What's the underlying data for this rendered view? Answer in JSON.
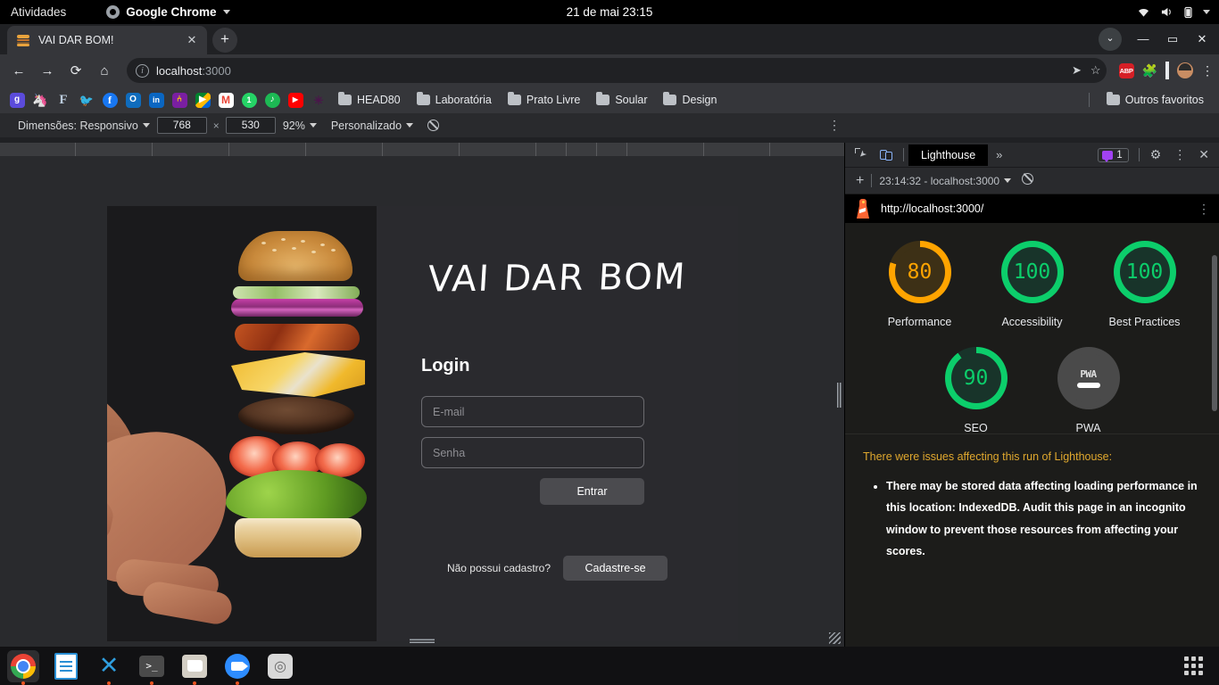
{
  "os_bar": {
    "activities": "Atividades",
    "app_name": "Google Chrome",
    "clock": "21 de mai  23:15",
    "tray": [
      "wifi-icon",
      "volume-icon",
      "battery-icon",
      "chevron-down-icon"
    ]
  },
  "browser": {
    "tab": {
      "title": "VAI DAR BOM!",
      "favicon": "burger-icon",
      "close": "✕"
    },
    "new_tab": "+",
    "window_controls": {
      "minimize": "—",
      "maximize": "▭",
      "close": "✕",
      "chevron": "⌄"
    },
    "nav": {
      "back": "←",
      "forward": "→",
      "reload": "⟳",
      "home": "⌂"
    },
    "omnibox": {
      "info_icon": "i",
      "host": "localhost",
      "port": ":3000",
      "share_icon": "➤",
      "star_icon": "☆"
    },
    "extensions": [
      "ABP",
      "puzzle-icon",
      "square-icon",
      "avatar-icon",
      "kebab-menu-icon"
    ],
    "bookmarks": {
      "icons": [
        "g",
        "unicorn",
        "F",
        "twitter",
        "facebook",
        "outlook",
        "linkedin",
        "analytics",
        "meet",
        "gmail",
        "whatsapp",
        "spotify",
        "youtube",
        "slack"
      ],
      "folders": [
        "HEAD80",
        "Laboratória",
        "Prato Livre",
        "Soular",
        "Design"
      ],
      "other": "Outros favoritos"
    }
  },
  "device_toolbar": {
    "dimensions_label": "Dimensões: Responsivo",
    "width": "768",
    "height": "530",
    "multiply": "×",
    "zoom": "92%",
    "preset": "Personalizado",
    "throttling_icon": "no-throttling-icon",
    "kebab": "⋮"
  },
  "page": {
    "logo": "VAI DAR BOM",
    "heading": "Login",
    "email_placeholder": "E-mail",
    "password_placeholder": "Senha",
    "email_value": "",
    "password_value": "",
    "submit_label": "Entrar",
    "signup_question": "Não possui cadastro?",
    "signup_label": "Cadastre-se",
    "hero_alt": "exploded-burger-on-hand-photo"
  },
  "devtools": {
    "tabs": {
      "active": "Lighthouse",
      "more": "»"
    },
    "badge_count": "1",
    "gear_icon": "⚙",
    "kebab_icon": "⋮",
    "close_icon": "✕",
    "lighthouse_toolbar": {
      "add": "+",
      "run_selector": "23:14:32 - localhost:3000",
      "clear_icon": "clear-icon"
    },
    "report": {
      "url": "http://localhost:3000/",
      "kebab": "⋮",
      "gauges": [
        {
          "label": "Performance",
          "score": "80",
          "color": "#ffa400",
          "bg": "#3d3016",
          "arc": 80
        },
        {
          "label": "Accessibility",
          "score": "100",
          "color": "#0cce6b",
          "bg": "#18342a",
          "arc": 100
        },
        {
          "label": "Best Practices",
          "score": "100",
          "color": "#0cce6b",
          "bg": "#18342a",
          "arc": 100
        },
        {
          "label": "SEO",
          "score": "90",
          "color": "#0cce6b",
          "bg": "#18342a",
          "arc": 90
        },
        {
          "label": "PWA",
          "score": "PWA",
          "color": "#e0e0e0",
          "bg": "#4a4a4a",
          "arc": 0
        }
      ],
      "warning_title": "There were issues affecting this run of Lighthouse:",
      "warning_items": [
        "There may be stored data affecting loading performance in this location: IndexedDB. Audit this page in an incognito window to prevent those resources from affecting your scores."
      ]
    }
  },
  "dock": {
    "items": [
      "Google Chrome",
      "LibreOffice Writer",
      "Visual Studio Code",
      "Terminal",
      "Arquivos",
      "Zoom",
      "Configurações"
    ],
    "app_grid": "show-applications-icon"
  }
}
